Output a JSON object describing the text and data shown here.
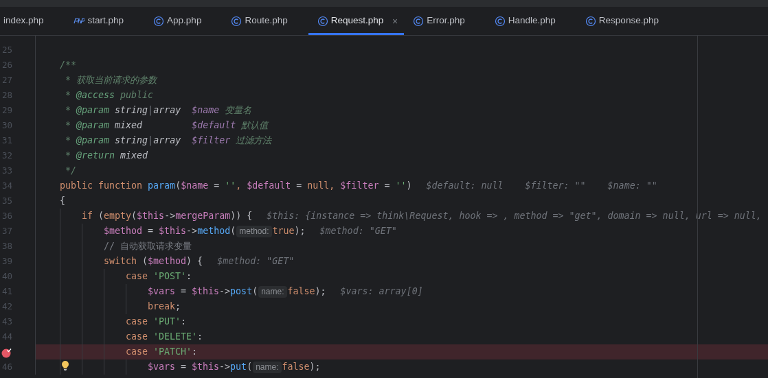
{
  "tabs": [
    {
      "label": "index.php",
      "kind": "plain",
      "selected": false
    },
    {
      "label": "start.php",
      "kind": "php",
      "selected": false
    },
    {
      "label": "App.php",
      "kind": "class",
      "selected": false
    },
    {
      "label": "Route.php",
      "kind": "class",
      "selected": false
    },
    {
      "label": "Request.php",
      "kind": "class",
      "selected": true,
      "close": "×"
    },
    {
      "label": "Error.php",
      "kind": "class",
      "selected": false
    },
    {
      "label": "Handle.php",
      "kind": "class",
      "selected": false
    },
    {
      "label": "Response.php",
      "kind": "class",
      "selected": false
    }
  ],
  "editor": {
    "lines": [
      {
        "number": "25",
        "breakpoint": false
      },
      {
        "number": "26",
        "breakpoint": false,
        "tokens": [
          {
            "text": "    /**",
            "kind": "doc"
          }
        ]
      },
      {
        "number": "27",
        "breakpoint": false,
        "tokens": [
          {
            "text": "     * 获取当前请求的参数",
            "kind": "doc"
          }
        ]
      },
      {
        "number": "28",
        "breakpoint": false,
        "tokens": [
          {
            "text": "     * ",
            "kind": "doc"
          },
          {
            "text": "@access",
            "kind": "doctag"
          },
          {
            "text": " public",
            "kind": "doc"
          }
        ]
      },
      {
        "number": "29",
        "breakpoint": false,
        "tokens": [
          {
            "text": "     * ",
            "kind": "doc"
          },
          {
            "text": "@param",
            "kind": "doctag"
          },
          {
            "text": " string",
            "kind": "doctype"
          },
          {
            "text": "|",
            "kind": "docsep"
          },
          {
            "text": "array  ",
            "kind": "doctype"
          },
          {
            "text": "$name",
            "kind": "docvar"
          },
          {
            "text": " 变量名",
            "kind": "doc"
          }
        ]
      },
      {
        "number": "30",
        "breakpoint": false,
        "tokens": [
          {
            "text": "     * ",
            "kind": "doc"
          },
          {
            "text": "@param",
            "kind": "doctag"
          },
          {
            "text": " mixed         ",
            "kind": "doctype"
          },
          {
            "text": "$default",
            "kind": "docvar"
          },
          {
            "text": " 默认值",
            "kind": "doc"
          }
        ]
      },
      {
        "number": "31",
        "breakpoint": false,
        "tokens": [
          {
            "text": "     * ",
            "kind": "doc"
          },
          {
            "text": "@param",
            "kind": "doctag"
          },
          {
            "text": " string",
            "kind": "doctype"
          },
          {
            "text": "|",
            "kind": "docsep"
          },
          {
            "text": "array  ",
            "kind": "doctype"
          },
          {
            "text": "$filter",
            "kind": "docvar"
          },
          {
            "text": " 过滤方法",
            "kind": "doc"
          }
        ]
      },
      {
        "number": "32",
        "breakpoint": false,
        "tokens": [
          {
            "text": "     * ",
            "kind": "doc"
          },
          {
            "text": "@return",
            "kind": "doctag"
          },
          {
            "text": " mixed",
            "kind": "doctype"
          }
        ]
      },
      {
        "number": "33",
        "breakpoint": false,
        "tokens": [
          {
            "text": "     */",
            "kind": "doc"
          }
        ]
      },
      {
        "number": "34",
        "breakpoint": false,
        "tokens": [
          {
            "text": "    public function ",
            "kind": "kw"
          },
          {
            "text": "param",
            "kind": "fn"
          },
          {
            "text": "(",
            "kind": "plain"
          },
          {
            "text": "$name",
            "kind": "var"
          },
          {
            "text": " = ",
            "kind": "plain"
          },
          {
            "text": "''",
            "kind": "str"
          },
          {
            "text": ", ",
            "kind": "kw"
          },
          {
            "text": "$default",
            "kind": "var"
          },
          {
            "text": " = ",
            "kind": "plain"
          },
          {
            "text": "null",
            "kind": "kw"
          },
          {
            "text": ", ",
            "kind": "kw"
          },
          {
            "text": "$filter",
            "kind": "var"
          },
          {
            "text": " = ",
            "kind": "plain"
          },
          {
            "text": "''",
            "kind": "str"
          },
          {
            "text": ")",
            "kind": "plain"
          },
          {
            "text": "$default: null",
            "kind": "hint"
          },
          {
            "text": "$filter: \"\"",
            "kind": "hint"
          },
          {
            "text": "$name: \"\"",
            "kind": "hint"
          }
        ]
      },
      {
        "number": "35",
        "breakpoint": false,
        "tokens": [
          {
            "text": "    {",
            "kind": "plain"
          }
        ]
      },
      {
        "number": "36",
        "breakpoint": false,
        "tokens": [
          {
            "text": "        if ",
            "kind": "kw"
          },
          {
            "text": "(",
            "kind": "plain"
          },
          {
            "text": "empty",
            "kind": "kw"
          },
          {
            "text": "(",
            "kind": "plain"
          },
          {
            "text": "$this",
            "kind": "var"
          },
          {
            "text": "->",
            "kind": "plain"
          },
          {
            "text": "mergeParam",
            "kind": "var"
          },
          {
            "text": ")) {",
            "kind": "plain"
          },
          {
            "text": "$this: {instance => think\\Request, hook => , method => \"get\", domain => null, url => null,",
            "kind": "hint"
          }
        ]
      },
      {
        "number": "37",
        "breakpoint": false,
        "tokens": [
          {
            "text": "            $method",
            "kind": "var"
          },
          {
            "text": " = ",
            "kind": "plain"
          },
          {
            "text": "$this",
            "kind": "var"
          },
          {
            "text": "->",
            "kind": "plain"
          },
          {
            "text": "method",
            "kind": "fn"
          },
          {
            "text": "(",
            "kind": "plain"
          },
          {
            "text": "method:",
            "kind": "param"
          },
          {
            "text": "true",
            "kind": "kw"
          },
          {
            "text": ");",
            "kind": "plain"
          },
          {
            "text": "$method: \"GET\"",
            "kind": "hint"
          }
        ]
      },
      {
        "number": "38",
        "breakpoint": false,
        "tokens": [
          {
            "text": "            // 自动获取请求变量",
            "kind": "comment"
          }
        ]
      },
      {
        "number": "39",
        "breakpoint": false,
        "tokens": [
          {
            "text": "            switch ",
            "kind": "kw"
          },
          {
            "text": "(",
            "kind": "plain"
          },
          {
            "text": "$method",
            "kind": "var"
          },
          {
            "text": ") {",
            "kind": "plain"
          },
          {
            "text": "$method: \"GET\"",
            "kind": "hint"
          }
        ]
      },
      {
        "number": "40",
        "breakpoint": false,
        "tokens": [
          {
            "text": "                case ",
            "kind": "kw"
          },
          {
            "text": "'POST'",
            "kind": "str"
          },
          {
            "text": ":",
            "kind": "plain"
          }
        ]
      },
      {
        "number": "41",
        "breakpoint": false,
        "tokens": [
          {
            "text": "                    $vars",
            "kind": "var"
          },
          {
            "text": " = ",
            "kind": "plain"
          },
          {
            "text": "$this",
            "kind": "var"
          },
          {
            "text": "->",
            "kind": "plain"
          },
          {
            "text": "post",
            "kind": "fn"
          },
          {
            "text": "(",
            "kind": "plain"
          },
          {
            "text": "name:",
            "kind": "param"
          },
          {
            "text": "false",
            "kind": "kw"
          },
          {
            "text": ");",
            "kind": "plain"
          },
          {
            "text": "$vars: array[0]",
            "kind": "hint"
          }
        ]
      },
      {
        "number": "42",
        "breakpoint": false,
        "tokens": [
          {
            "text": "                    break",
            "kind": "kw"
          },
          {
            "text": ";",
            "kind": "plain"
          }
        ]
      },
      {
        "number": "43",
        "breakpoint": false,
        "tokens": [
          {
            "text": "                case ",
            "kind": "kw"
          },
          {
            "text": "'PUT'",
            "kind": "str"
          },
          {
            "text": ":",
            "kind": "plain"
          }
        ]
      },
      {
        "number": "44",
        "breakpoint": false,
        "tokens": [
          {
            "text": "                case ",
            "kind": "kw"
          },
          {
            "text": "'DELETE'",
            "kind": "str"
          },
          {
            "text": ":",
            "kind": "plain"
          }
        ]
      },
      {
        "breakpoint": true,
        "tokens": [
          {
            "text": "                case ",
            "kind": "kw"
          },
          {
            "text": "'PATCH'",
            "kind": "str"
          },
          {
            "text": ":",
            "kind": "plain"
          }
        ]
      },
      {
        "number": "46",
        "breakpoint": false,
        "intention": true,
        "tokens": [
          {
            "text": "                    $vars",
            "kind": "var"
          },
          {
            "text": " = ",
            "kind": "plain"
          },
          {
            "text": "$this",
            "kind": "var"
          },
          {
            "text": "->",
            "kind": "plain"
          },
          {
            "text": "put",
            "kind": "fn"
          },
          {
            "text": "(",
            "kind": "plain"
          },
          {
            "text": "name:",
            "kind": "param"
          },
          {
            "text": "false",
            "kind": "kw"
          },
          {
            "text": ");",
            "kind": "plain"
          }
        ]
      }
    ]
  }
}
